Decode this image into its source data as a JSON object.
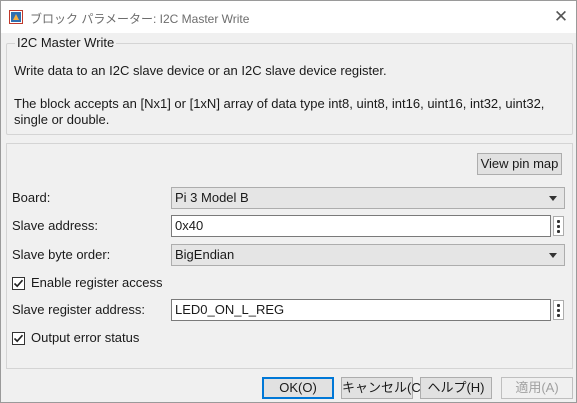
{
  "window": {
    "title": "ブロック パラメーター: I2C Master Write",
    "close_glyph": "✕"
  },
  "description": {
    "group_title": "I2C Master Write",
    "line1": "Write data to an I2C slave device or an I2C slave device register.",
    "line2": "The block accepts an [Nx1] or [1xN] array of data type int8, uint8, int16, uint16, int32, uint32,",
    "line3": "single or double."
  },
  "params": {
    "view_pin_map_label": "View pin map",
    "board": {
      "label": "Board:",
      "value": "Pi 3 Model B"
    },
    "slave_address": {
      "label": "Slave address:",
      "value": "0x40"
    },
    "slave_byte_order": {
      "label": "Slave byte order:",
      "value": "BigEndian"
    },
    "enable_register_access": {
      "label": "Enable register access",
      "checked": true
    },
    "slave_register_address": {
      "label": "Slave register address:",
      "value": "LED0_ON_L_REG"
    },
    "output_error_status": {
      "label": "Output error status",
      "checked": true
    }
  },
  "buttons": {
    "ok": "OK(O)",
    "cancel": "キャンセル(C)",
    "help": "ヘルプ(H)",
    "apply": "適用(A)"
  },
  "colors": {
    "accent": "#0078d7",
    "dialog_bg": "#f0f0f0"
  },
  "icons": {
    "app": "simulink-block-icon",
    "close": "close-icon",
    "dropdown": "chevron-down-icon",
    "more": "vertical-ellipsis-icon",
    "check": "checkmark-icon"
  }
}
